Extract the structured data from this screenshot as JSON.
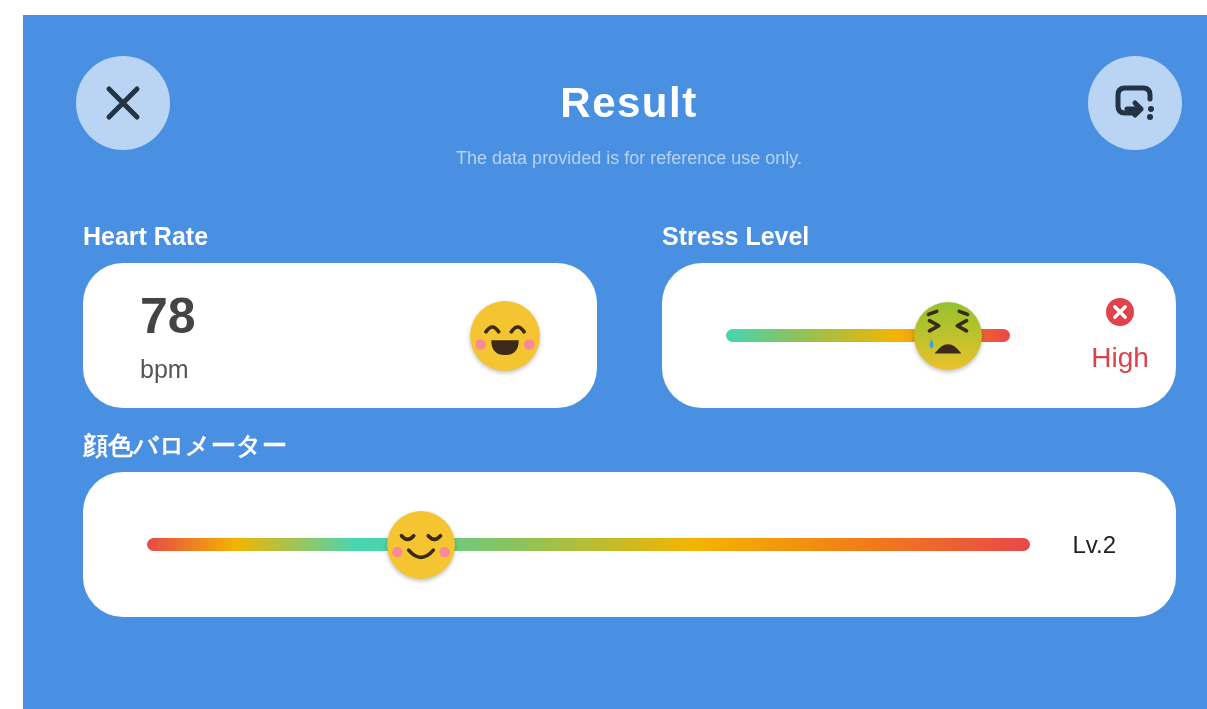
{
  "header": {
    "title": "Result",
    "subtitle": "The data provided is for reference use only."
  },
  "heart_rate": {
    "label": "Heart Rate",
    "value": "78",
    "unit": "bpm"
  },
  "stress_level": {
    "label": "Stress Level",
    "kind": "stress",
    "level": 0.78,
    "alert": true,
    "reading": "High"
  },
  "barometer": {
    "label": "顔色バロメーター",
    "kind": "barometer",
    "level": 0.31,
    "reading": "Lv.2"
  }
}
